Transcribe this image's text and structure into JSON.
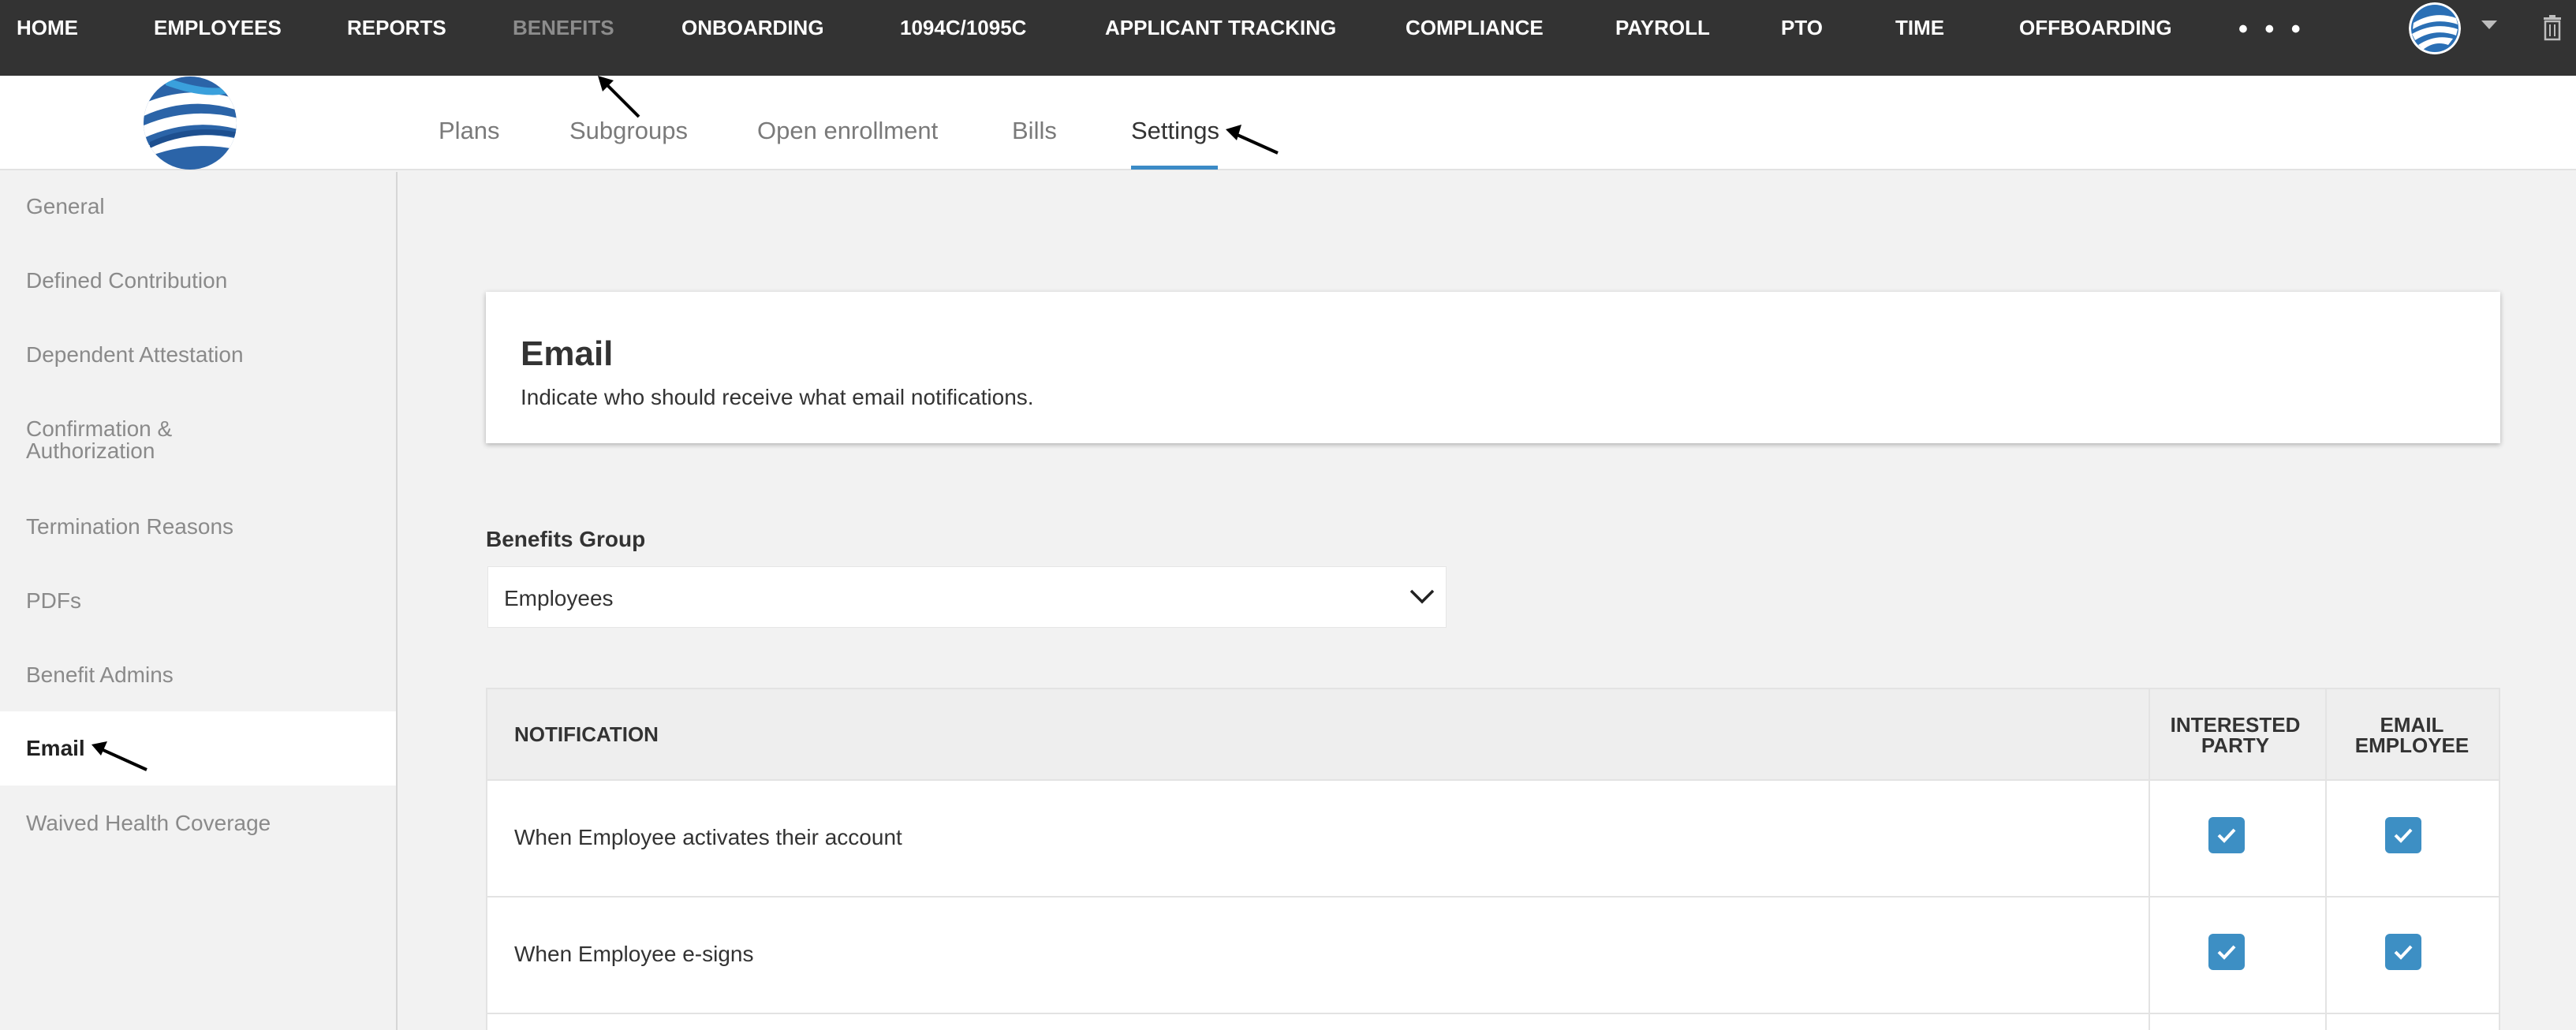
{
  "topnav": {
    "items": [
      "HOME",
      "EMPLOYEES",
      "REPORTS",
      "BENEFITS",
      "ONBOARDING",
      "1094C/1095C",
      "APPLICANT TRACKING",
      "COMPLIANCE",
      "PAYROLL",
      "PTO",
      "TIME",
      "OFFBOARDING"
    ],
    "active": "BENEFITS",
    "more": "• • •",
    "icons": [
      "avatar-globe-icon",
      "caret-down-icon",
      "trash-icon"
    ]
  },
  "subnav": {
    "tabs": [
      "Plans",
      "Subgroups",
      "Open enrollment",
      "Bills",
      "Settings"
    ],
    "active": "Settings"
  },
  "sidebar": {
    "items": [
      "General",
      "Defined Contribution",
      "Dependent Attestation",
      "Confirmation & Authorization",
      "Termination Reasons",
      "PDFs",
      "Benefit Admins",
      "Email",
      "Waived Health Coverage"
    ],
    "active": "Email"
  },
  "card": {
    "title": "Email",
    "description": "Indicate who should receive what email notifications."
  },
  "benefits_group": {
    "label": "Benefits Group",
    "value": "Employees"
  },
  "table": {
    "headers": {
      "notification": "NOTIFICATION",
      "interested_party_1": "INTERESTED",
      "interested_party_2": "PARTY",
      "email_employee_1": "EMAIL",
      "email_employee_2": "EMPLOYEE"
    },
    "rows": [
      {
        "label": "When Employee activates their account",
        "interested_party": true,
        "email_employee": true
      },
      {
        "label": "When Employee e-signs",
        "interested_party": true,
        "email_employee": true
      }
    ]
  },
  "colors": {
    "topnav_bg": "#333333",
    "accent": "#3b8bc6",
    "checkbox": "#3d8fc4",
    "page_bg": "#f2f2f2"
  }
}
